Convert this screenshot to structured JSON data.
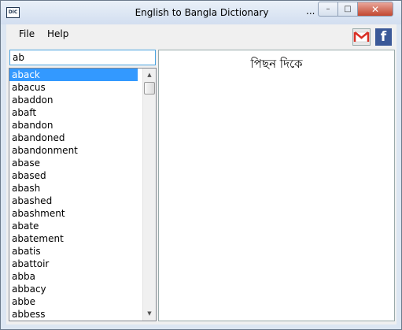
{
  "window": {
    "title": "English to Bangla Dictionary",
    "extra": "...",
    "icon_label": "DIC"
  },
  "controls": {
    "minimize": "–",
    "maximize": "□",
    "close": "✕"
  },
  "menu": {
    "file": "File",
    "help": "Help"
  },
  "toolbar": {
    "gmail_icon": "gmail-icon",
    "facebook_icon": "facebook-icon",
    "facebook_glyph": "f"
  },
  "search": {
    "value": "ab"
  },
  "list": {
    "items": [
      "aback",
      "abacus",
      "abaddon",
      "abaft",
      "abandon",
      "abandoned",
      "abandonment",
      "abase",
      "abased",
      "abash",
      "abashed",
      "abashment",
      "abate",
      "abatement",
      "abatis",
      "abattoir",
      "abba",
      "abbacy",
      "abbe",
      "abbess"
    ],
    "selected": "aback"
  },
  "meaning": {
    "text": "পিছন দিকে"
  },
  "colors": {
    "selection": "#3399ff",
    "facebook": "#3b5998",
    "close": "#c2472f",
    "gmail_red": "#d93025"
  }
}
